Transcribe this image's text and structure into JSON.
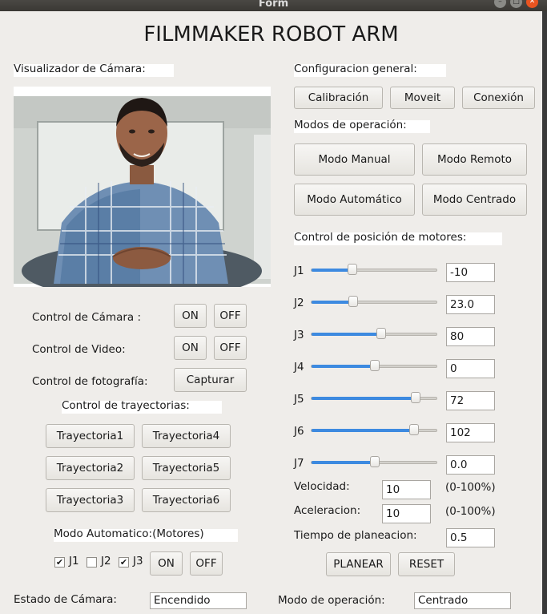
{
  "window": {
    "title": "Form"
  },
  "app_title": "FILMMAKER ROBOT ARM",
  "camera": {
    "section_label": "Visualizador de Cámara:",
    "control_camera_label": "Control de Cámara :",
    "control_video_label": "Control de Video:",
    "control_photo_label": "Control de fotografía:",
    "on_label": "ON",
    "off_label": "OFF",
    "capture_label": "Capturar"
  },
  "trajectories": {
    "title": "Control de trayectorias:",
    "buttons": [
      "Trayectoria1",
      "Trayectoria4",
      "Trayectoria2",
      "Trayectoria5",
      "Trayectoria3",
      "Trayectoria6"
    ]
  },
  "auto_mode": {
    "title": "Modo Automatico:(Motores)",
    "checks": [
      {
        "label": "J1",
        "checked": true
      },
      {
        "label": "J2",
        "checked": false
      },
      {
        "label": "J3",
        "checked": true
      }
    ],
    "on_label": "ON",
    "off_label": "OFF"
  },
  "general": {
    "title": "Configuracion general:",
    "buttons": [
      "Calibración",
      "Moveit",
      "Conexión"
    ]
  },
  "modes": {
    "title": "Modos de operación:",
    "buttons": [
      "Modo Manual",
      "Modo Remoto",
      "Modo Automático",
      "Modo Centrado"
    ]
  },
  "motors": {
    "title": "Control de posición de motores:",
    "joints": [
      {
        "label": "J1",
        "value": "-10",
        "slider": 0.32
      },
      {
        "label": "J2",
        "value": "23.0",
        "slider": 0.33
      },
      {
        "label": "J3",
        "value": "80",
        "slider": 0.55
      },
      {
        "label": "J4",
        "value": "0",
        "slider": 0.5
      },
      {
        "label": "J5",
        "value": "72",
        "slider": 0.82
      },
      {
        "label": "J6",
        "value": "102",
        "slider": 0.81
      },
      {
        "label": "J7",
        "value": "0.0",
        "slider": 0.5
      }
    ],
    "velocity_label": "Velocidad:",
    "velocity_value": "10",
    "velocity_range": "(0-100%)",
    "accel_label": "Aceleracion:",
    "accel_value": "10",
    "accel_range": "(0-100%)",
    "planning_time_label": "Tiempo de planeacion:",
    "planning_time_value": "0.5",
    "plan_label": "PLANEAR",
    "reset_label": "RESET"
  },
  "status": {
    "camera_label": "Estado de  Cámara:",
    "camera_value": "Encendido",
    "mode_label": "Modo de operación:",
    "mode_value": "Centrado"
  },
  "colors": {
    "slider_fill": "#3d8ae0",
    "close_button": "#e95420",
    "form_background": "#efedea"
  }
}
